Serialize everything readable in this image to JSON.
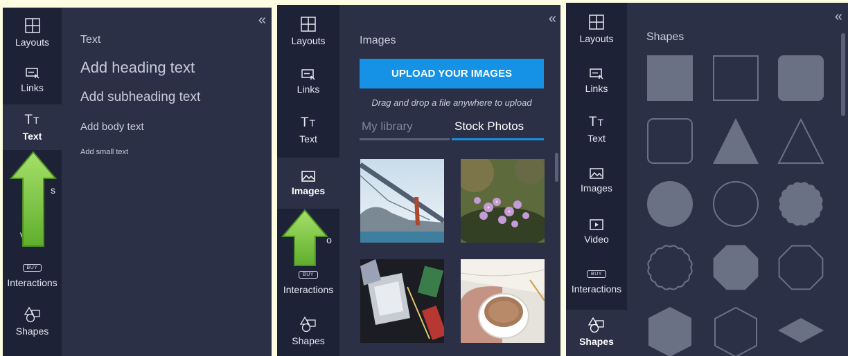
{
  "nav": {
    "layouts": "Layouts",
    "links": "Links",
    "text": "Text",
    "images": "Images",
    "video": "Video",
    "interactions": "Interactions",
    "shapes": "Shapes",
    "text_icon_glyph": "T",
    "text_icon_small": "T",
    "buy_badge": "BUY",
    "partial_images_label": "s",
    "partial_video_label": "o"
  },
  "collapse_glyph": "«",
  "text_panel": {
    "title": "Text",
    "options": [
      "Add heading text",
      "Add subheading text",
      "Add body text",
      "Add small text"
    ]
  },
  "images_panel": {
    "title": "Images",
    "upload_button": "UPLOAD YOUR IMAGES",
    "drag_hint": "Drag and drop a file anywhere to upload",
    "tabs": [
      "My library",
      "Stock Photos"
    ],
    "active_tab": "Stock Photos",
    "photos": [
      "golden-gate-bridge",
      "purple-flowers",
      "notebooks-on-desk",
      "coffee-cup-with-book"
    ]
  },
  "shapes_panel": {
    "title": "Shapes",
    "shapes": [
      "filled-square",
      "outline-square",
      "filled-rounded-square",
      "outline-rounded-square",
      "filled-triangle",
      "outline-triangle",
      "filled-circle",
      "outline-circle",
      "filled-scalloped-circle",
      "outline-scalloped-circle",
      "filled-octagon",
      "outline-octagon",
      "filled-hexagon",
      "outline-hexagon",
      "filled-diamond"
    ]
  },
  "colors": {
    "background": "#fdfde2",
    "panel": "#2b3047",
    "rail": "#1e2236",
    "accent": "#1592e6",
    "shape_fill": "#6b7185",
    "arrow": "#7fcf3a"
  }
}
